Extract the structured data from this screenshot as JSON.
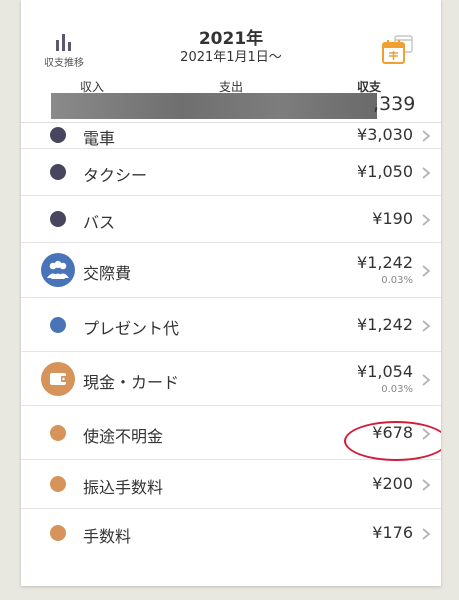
{
  "header": {
    "trend_label": "収支推移",
    "title": "2021年",
    "period": "2021年1月1日〜",
    "labels": {
      "income": "収入",
      "expense": "支出",
      "balance": "収支"
    },
    "balance_value": ",339"
  },
  "colors": {
    "navy": "#48465e",
    "blue": "#4a74b8",
    "orange": "#d6935a",
    "accent_calendar": "#f0a030",
    "highlight": "#d21e3c"
  },
  "rows": [
    {
      "name": "電車",
      "amount": "¥3,030",
      "icon": "dot",
      "color": "navy"
    },
    {
      "name": "タクシー",
      "amount": "¥1,050",
      "icon": "dot",
      "color": "navy"
    },
    {
      "name": "バス",
      "amount": "¥190",
      "icon": "dot",
      "color": "navy"
    },
    {
      "name": "交際費",
      "amount": "¥1,242",
      "percent": "0.03%",
      "icon": "people-icon",
      "color": "blue"
    },
    {
      "name": "プレゼント代",
      "amount": "¥1,242",
      "icon": "dot",
      "color": "blue"
    },
    {
      "name": "現金・カード",
      "amount": "¥1,054",
      "percent": "0.03%",
      "icon": "wallet-icon",
      "color": "orange"
    },
    {
      "name": "使途不明金",
      "amount": "¥678",
      "icon": "dot",
      "color": "orange"
    },
    {
      "name": "振込手数料",
      "amount": "¥200",
      "icon": "dot",
      "color": "orange"
    },
    {
      "name": "手数料",
      "amount": "¥176",
      "icon": "dot",
      "color": "orange"
    }
  ]
}
